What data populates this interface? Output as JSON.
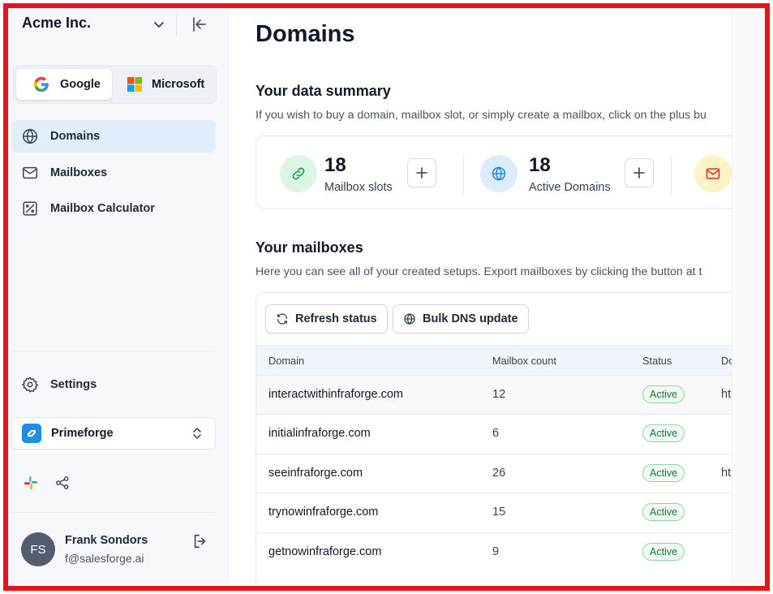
{
  "sidebar": {
    "org_name": "Acme Inc.",
    "providers": [
      {
        "label": "Google",
        "selected": true
      },
      {
        "label": "Microsoft",
        "selected": false
      }
    ],
    "nav": [
      {
        "label": "Domains",
        "icon": "globe-icon",
        "active": true
      },
      {
        "label": "Mailboxes",
        "icon": "mail-icon",
        "active": false
      },
      {
        "label": "Mailbox Calculator",
        "icon": "calculator-icon",
        "active": false
      }
    ],
    "settings_label": "Settings",
    "workspace": {
      "label": "Primeforge",
      "icon": "primeforge-logo"
    },
    "extras": [
      {
        "icon": "slack-icon"
      },
      {
        "icon": "share-icon"
      }
    ],
    "user": {
      "initials": "FS",
      "name": "Frank Sondors",
      "email": "f@salesforge.ai"
    }
  },
  "main": {
    "title": "Domains",
    "summary": {
      "title": "Your data summary",
      "subtitle": "If you wish to buy a domain, mailbox slot, or simply create a mailbox, click on the plus bu",
      "stats": [
        {
          "value": "18",
          "label": "Mailbox slots",
          "icon": "link-icon"
        },
        {
          "value": "18",
          "label": "Active Domains",
          "icon": "globe-icon"
        },
        {
          "value": "",
          "label": "",
          "icon": "mail-icon"
        }
      ]
    },
    "mailboxes": {
      "title": "Your mailboxes",
      "subtitle": "Here you can see all of your created setups. Export mailboxes by clicking the button at t",
      "buttons": [
        {
          "label": "Refresh status",
          "icon": "refresh-icon"
        },
        {
          "label": "Bulk DNS update",
          "icon": "globe-icon"
        }
      ],
      "columns": [
        "Domain",
        "Mailbox count",
        "Status",
        "Do"
      ],
      "rows": [
        {
          "domain": "interactwithinfraforge.com",
          "count": "12",
          "status": "Active",
          "extra": "ht"
        },
        {
          "domain": "initialinfraforge.com",
          "count": "6",
          "status": "Active",
          "extra": ""
        },
        {
          "domain": "seeinfraforge.com",
          "count": "26",
          "status": "Active",
          "extra": "ht"
        },
        {
          "domain": "trynowinfraforge.com",
          "count": "15",
          "status": "Active",
          "extra": ""
        },
        {
          "domain": "getnowinfraforge.com",
          "count": "9",
          "status": "Active",
          "extra": ""
        }
      ]
    }
  },
  "colors": {
    "highlight_border": "#e3141b",
    "active_nav_bg": "#e1eefb",
    "status_green": "#157a3b",
    "workspace_blue": "#1e8de8"
  }
}
